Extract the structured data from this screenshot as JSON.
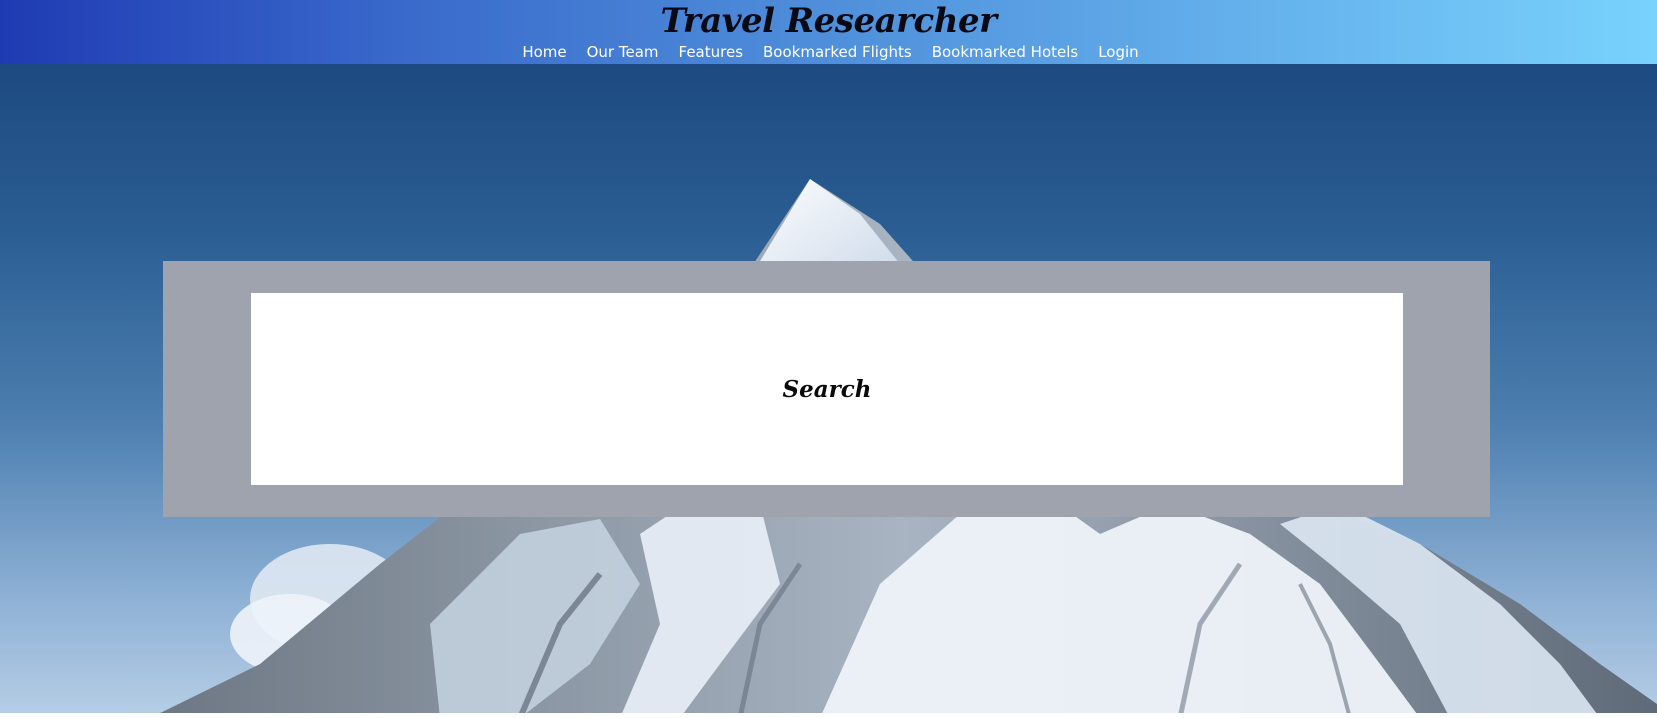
{
  "header": {
    "title": "Travel Researcher",
    "nav": [
      {
        "label": "Home"
      },
      {
        "label": "Our Team"
      },
      {
        "label": "Features"
      },
      {
        "label": "Bookmarked Flights"
      },
      {
        "label": "Bookmarked Hotels"
      },
      {
        "label": "Login"
      }
    ]
  },
  "search": {
    "label": "Search"
  },
  "colors": {
    "header_gradient_start": "#1f3bb3",
    "header_gradient_end": "#78d2fc",
    "panel_gray": "#9ea3ad",
    "sky_top": "#1d4a80",
    "snow": "#f2f6fb"
  }
}
